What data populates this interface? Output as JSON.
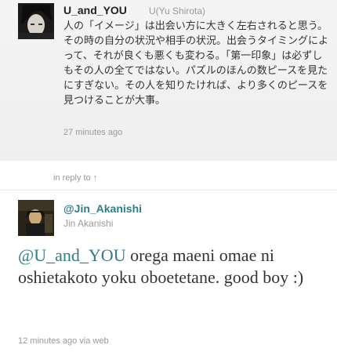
{
  "tweet": {
    "screen_name": "U_and_YOU",
    "full_name": "U(Yu Shirota)",
    "text": "人の「イメージ」は出会い方に大きく左右されると思う。その時の自分の状況や相手の状況。出会うタイミングによって、それが良くも悪くも変わる。「第一印象」は必ずしもその人の全てではない。パズルのほんの数ピースを見たにすぎない。その人を知りたければ、より多くのピースを見つけることが大事。",
    "timestamp": "27 minutes ago"
  },
  "in_reply_to": {
    "label": "in reply to",
    "arrow": "↑"
  },
  "reply": {
    "screen_name": "@Jin_Akanishi",
    "full_name": "Jin Akanishi",
    "mention": "@U_and_YOU",
    "text": " orega maeni omae ni oshietakoto yoku oboetetane. good boy :)",
    "timestamp": "12 minutes ago",
    "via_prefix": "via",
    "via_source": "web"
  },
  "colors": {
    "link": "#2f7c8c",
    "meta": "#999999",
    "top_background": "#f4f4f4"
  }
}
